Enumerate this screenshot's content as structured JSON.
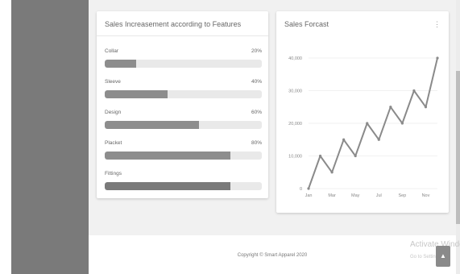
{
  "features_card": {
    "title": "Sales Increasement according to Features",
    "items": [
      {
        "label": "Collar",
        "percent_label": "20%",
        "value": 20
      },
      {
        "label": "Sleeve",
        "percent_label": "40%",
        "value": 40
      },
      {
        "label": "Design",
        "percent_label": "60%",
        "value": 60
      },
      {
        "label": "Placket",
        "percent_label": "80%",
        "value": 80
      },
      {
        "label": "Fittings",
        "percent_label": "",
        "value": 80
      }
    ]
  },
  "forecast_card": {
    "title": "Sales Forcast",
    "menu_icon": "kebab-menu-icon"
  },
  "chart_data": {
    "type": "line",
    "title": "",
    "xlabel": "",
    "ylabel": "",
    "x": [
      0,
      1,
      2,
      3,
      4,
      5,
      6,
      7,
      8,
      9,
      10,
      11,
      12
    ],
    "x_tick_labels": [
      "Jan",
      "Mar",
      "May",
      "Jul",
      "Sep",
      "Nov"
    ],
    "y_tick_labels": [
      "0",
      "10,000",
      "20,000",
      "30,000",
      "40,000"
    ],
    "y_ticks": [
      0,
      10000,
      20000,
      30000,
      40000
    ],
    "ylim": [
      0,
      40000
    ],
    "series": [
      {
        "values": [
          0,
          10000,
          5000,
          15000,
          10000,
          20000,
          15000,
          25000,
          20000,
          30000,
          25000,
          40000
        ]
      }
    ],
    "grid": true,
    "line_color": "#8a8a8a"
  },
  "footer": {
    "copyright": "Copyright © Smart Apparel 2020"
  },
  "watermark": {
    "line1": "Activate Windo",
    "line2": "Go to Settin"
  },
  "back_to_top": {
    "icon": "chevron-up-icon"
  }
}
